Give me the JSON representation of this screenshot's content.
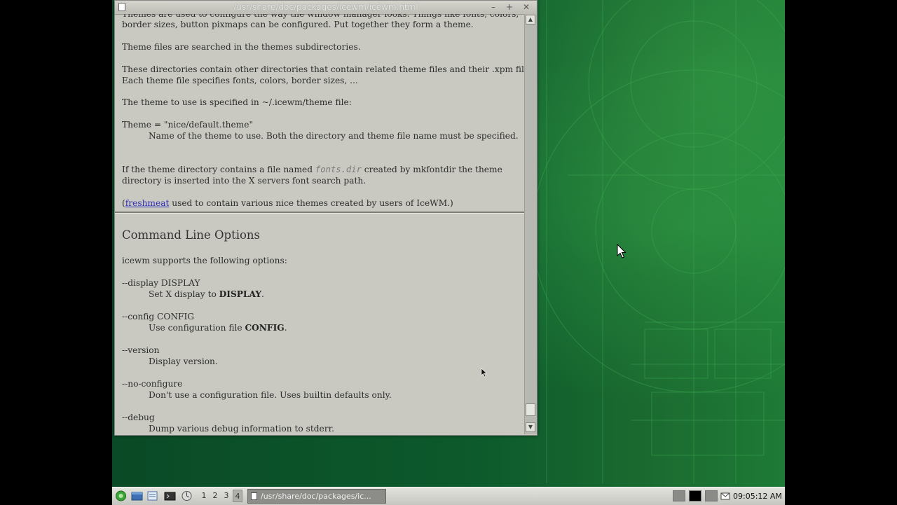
{
  "window": {
    "title": "/usr/share/doc/packages/icewm/icewm.html",
    "minimize": "–",
    "maximize": "+",
    "close": "✕"
  },
  "doc": {
    "p1_line1": "Themes are used to configure the way the window manager looks. Things like fonts, colors,",
    "p1_line2": "border sizes, button pixmaps can be configured. Put together they form a theme.",
    "p2": "Theme files are searched in the themes subdirectories.",
    "p3_line1": "These directories contain other directories that contain related theme files and their .xpm files.",
    "p3_line2": "Each theme file specifies fonts, colors, border sizes, ...",
    "p4": "The theme to use is specified in ~/.icewm/theme file:",
    "theme_option": "Theme = \"nice/default.theme\"",
    "theme_desc": "Name of the theme to use. Both the directory and theme file name must be specified.",
    "fonts_pre": "If the theme directory contains a file named ",
    "fonts_file": "fonts.dir",
    "fonts_post": " created by mkfontdir the theme",
    "fonts_line2": "directory is inserted into the X servers font search path.",
    "fm_open": "(",
    "fm_link": "freshmeat",
    "fm_text": " used to contain various nice themes created by users of IceWM.)",
    "heading": "Command Line Options",
    "intro": "icewm supports the following options:",
    "opt_display": "--display DISPLAY",
    "opt_display_desc_pre": "Set X display to ",
    "opt_display_desc_b": "DISPLAY",
    "opt_display_desc_post": ".",
    "opt_config": "--config CONFIG",
    "opt_config_desc_pre": "Use configuration file ",
    "opt_config_desc_b": "CONFIG",
    "opt_config_desc_post": ".",
    "opt_version": "--version",
    "opt_version_desc": "Display version.",
    "opt_noconf": "--no-configure",
    "opt_noconf_desc": "Don't use a configuration file. Uses builtin defaults only.",
    "opt_debug": "--debug",
    "opt_debug_desc": "Dump various debug information to stderr."
  },
  "scrollbar": {
    "up": "▲",
    "down": "▼",
    "position": 0.97
  },
  "taskbar": {
    "workspaces": [
      "1",
      "2",
      "3",
      "4"
    ],
    "active_workspace": "4",
    "task_title": "/usr/share/doc/packages/ic...",
    "clock": "09:05:12 AM",
    "icons": [
      "start-menu-icon",
      "show-desktop-icon",
      "window-list-icon",
      "terminal-icon",
      "browser-icon"
    ]
  },
  "colors": {
    "desktop": "#0d5a2c",
    "window_bg": "#c9c9c2",
    "link": "#2c2cb8"
  }
}
